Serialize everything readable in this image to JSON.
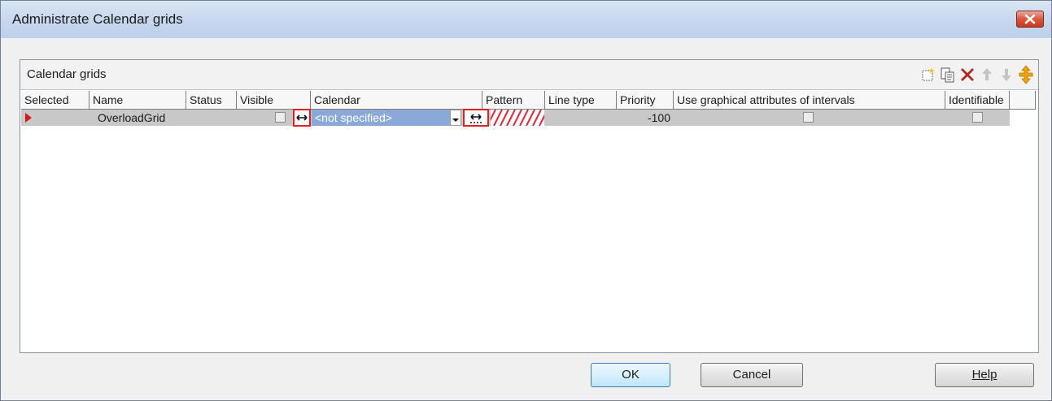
{
  "window": {
    "title": "Administrate Calendar grids"
  },
  "panel": {
    "title": "Calendar grids",
    "toolbar": [
      "new-icon",
      "copy-icon",
      "delete-icon",
      "move-up-icon",
      "move-down-icon",
      "resize-icon"
    ]
  },
  "grid": {
    "columns": [
      "Selected",
      "Name",
      "Status",
      "Visible",
      "Calendar",
      "Pattern",
      "Line type",
      "Priority",
      "Use graphical attributes of intervals",
      "Identifiable"
    ],
    "rows": [
      {
        "name": "OverloadGrid",
        "status": "",
        "visible": false,
        "calendar": "<not specified>",
        "pattern": "red-hatch",
        "line_type": "",
        "priority": "-100",
        "use_graphical_attributes": false,
        "identifiable": false
      }
    ]
  },
  "buttons": {
    "ok": "OK",
    "cancel": "Cancel",
    "help": "Help"
  },
  "colors": {
    "selection": "#c8c8c8",
    "calendar_cell": "#8aa8d8",
    "highlight_box": "#e02020",
    "marker": "#d61a1a"
  }
}
